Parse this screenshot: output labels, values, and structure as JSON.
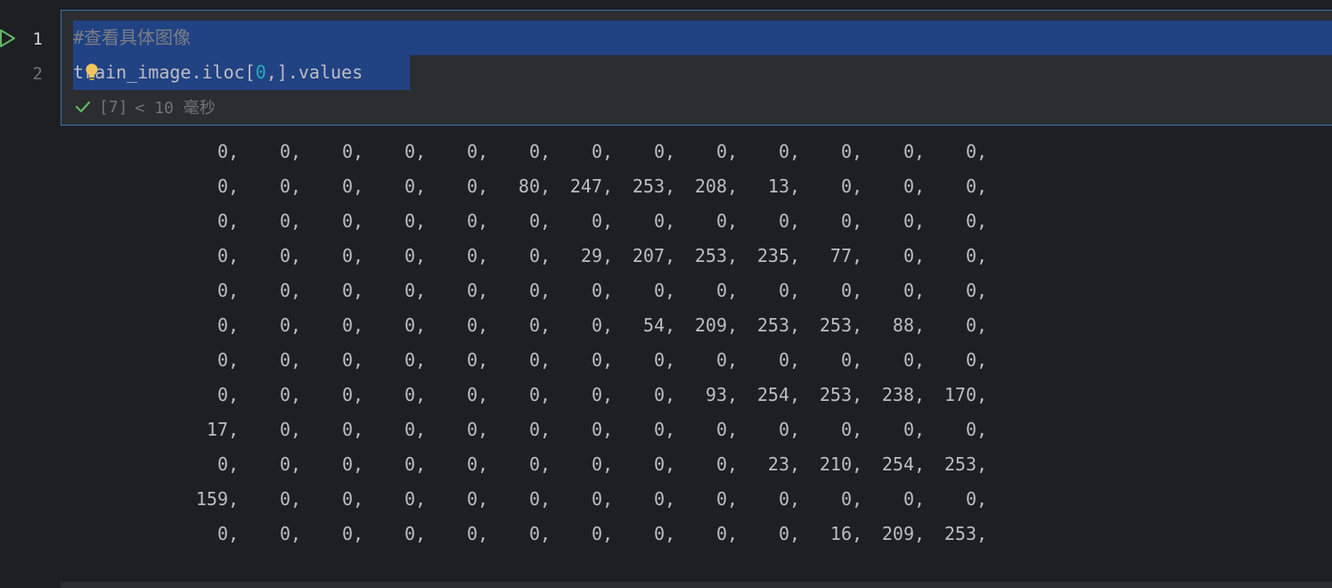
{
  "gutter": {
    "line_numbers": [
      "1",
      "2"
    ]
  },
  "cell": {
    "comment_line": "#查看具体图像",
    "code_prefix": "train_image.iloc[",
    "code_number": "0",
    "code_suffix": ",].values",
    "exec_count": "[7]",
    "exec_time": "< 10 毫秒"
  },
  "output": {
    "rows": [
      [
        "0",
        "0",
        "0",
        "0",
        "0",
        "0",
        "0",
        "0",
        "0",
        "0",
        "0",
        "0",
        "0"
      ],
      [
        "0",
        "0",
        "0",
        "0",
        "0",
        "80",
        "247",
        "253",
        "208",
        "13",
        "0",
        "0",
        "0"
      ],
      [
        "0",
        "0",
        "0",
        "0",
        "0",
        "0",
        "0",
        "0",
        "0",
        "0",
        "0",
        "0",
        "0"
      ],
      [
        "0",
        "0",
        "0",
        "0",
        "0",
        "0",
        "29",
        "207",
        "253",
        "235",
        "77",
        "0",
        "0"
      ],
      [
        "0",
        "0",
        "0",
        "0",
        "0",
        "0",
        "0",
        "0",
        "0",
        "0",
        "0",
        "0",
        "0"
      ],
      [
        "0",
        "0",
        "0",
        "0",
        "0",
        "0",
        "0",
        "54",
        "209",
        "253",
        "253",
        "88",
        "0"
      ],
      [
        "0",
        "0",
        "0",
        "0",
        "0",
        "0",
        "0",
        "0",
        "0",
        "0",
        "0",
        "0",
        "0"
      ],
      [
        "0",
        "0",
        "0",
        "0",
        "0",
        "0",
        "0",
        "0",
        "93",
        "254",
        "253",
        "238",
        "170"
      ],
      [
        "17",
        "0",
        "0",
        "0",
        "0",
        "0",
        "0",
        "0",
        "0",
        "0",
        "0",
        "0",
        "0"
      ],
      [
        "0",
        "0",
        "0",
        "0",
        "0",
        "0",
        "0",
        "0",
        "0",
        "23",
        "210",
        "254",
        "253"
      ],
      [
        "159",
        "0",
        "0",
        "0",
        "0",
        "0",
        "0",
        "0",
        "0",
        "0",
        "0",
        "0",
        "0"
      ],
      [
        "0",
        "0",
        "0",
        "0",
        "0",
        "0",
        "0",
        "0",
        "0",
        "0",
        "16",
        "209",
        "253"
      ]
    ]
  },
  "icons": {
    "run": "run-triangle-icon",
    "bulb": "lightbulb-icon",
    "check": "check-icon"
  },
  "colors": {
    "background": "#1e1f22",
    "cell_background": "#2b2d30",
    "cell_border": "#3574b0",
    "selection": "#214283",
    "run_icon": "#5fb865",
    "check": "#5fb865",
    "bulb": "#f2c55c",
    "number_token": "#2aacb8"
  }
}
